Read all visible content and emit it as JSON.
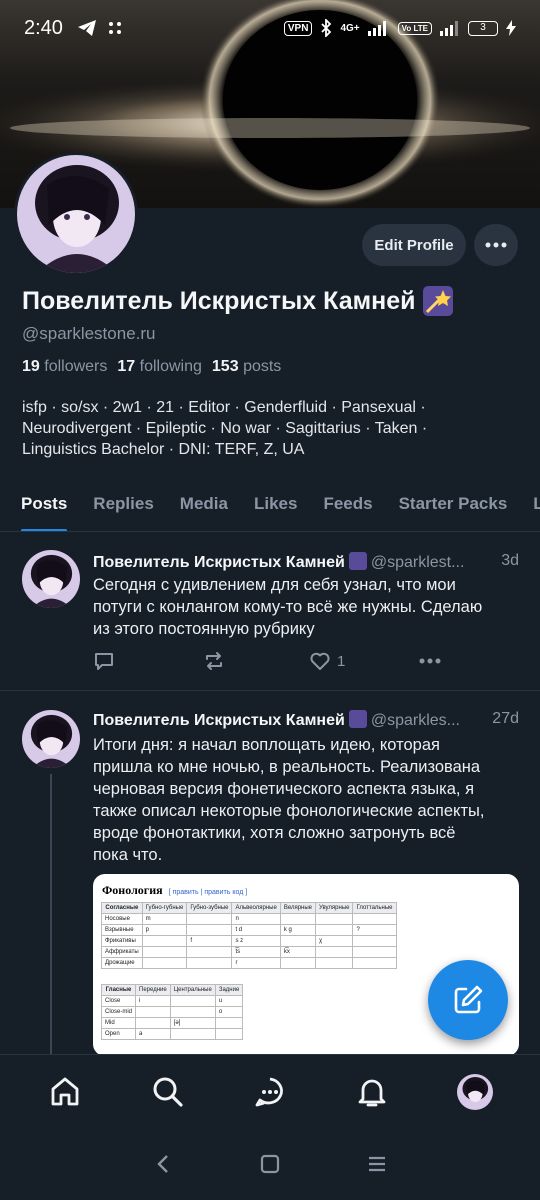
{
  "status_bar": {
    "time": "2:40",
    "vpn": "VPN",
    "network": "4G+",
    "volte": "Vo LTE",
    "battery": "3"
  },
  "profile": {
    "display_name": "Повелитель Искристых Камней",
    "handle": "@sparklestone.ru",
    "edit_label": "Edit Profile",
    "stats": {
      "followers_count": "19",
      "followers_label": "followers",
      "following_count": "17",
      "following_label": "following",
      "posts_count": "153",
      "posts_label": "posts"
    },
    "bio_lines": [
      "isfp · so/sx · 2w1 · 21 · Editor · Genderfluid · Pansexual ·",
      "Neurodivergent · Epileptic · No war · Sagittarius · Taken ·",
      "Linguistics Bachelor · DNI: TERF, Z, UA"
    ]
  },
  "tabs": [
    {
      "label": "Posts",
      "active": true
    },
    {
      "label": "Replies"
    },
    {
      "label": "Media"
    },
    {
      "label": "Likes"
    },
    {
      "label": "Feeds"
    },
    {
      "label": "Starter Packs"
    },
    {
      "label": "L"
    }
  ],
  "posts": [
    {
      "author": "Повелитель Искристых Камней",
      "handle": "@sparklest...",
      "age": "3d",
      "text_lines": [
        "Сегодня с удивлением для себя узнал, что мои",
        "потуги с конлангом кому-то всё же нужны. Сделаю",
        "из этого постоянную рубрику"
      ],
      "like_count": "1"
    },
    {
      "author": "Повелитель Искристых Камней",
      "handle": "@sparkles...",
      "age": "27d",
      "text_lines": [
        "Итоги дня: я начал воплощать идею, которая",
        "пришла ко мне ночью, в реальность. Реализована",
        "черновая версия фонетического аспекта языка, я",
        "также описал некоторые фонологические аспекты,",
        "вроде фонотактики, хотя сложно затронуть всё",
        "пока что."
      ],
      "image": {
        "title": "Фонология",
        "edit_links": "[ править | править код ]",
        "consonants": {
          "header": [
            "Согласные",
            "Губно-губные",
            "Губно-зубные",
            "Альвеолярные",
            "Велярные",
            "Увулярные",
            "Глоттальные"
          ],
          "rows": [
            [
              "Носовые",
              "m",
              "",
              "n",
              "",
              "",
              ""
            ],
            [
              "Взрывные",
              "p",
              "",
              "t    d",
              "k    g",
              "",
              "?"
            ],
            [
              "Фрикативы",
              "",
              "f",
              "s    z",
              "",
              "χ",
              ""
            ],
            [
              "Аффрикаты",
              "",
              "",
              "t͡s",
              "k͡x",
              "",
              ""
            ],
            [
              "Дрожащие",
              "",
              "",
              "r",
              "",
              "",
              ""
            ]
          ]
        },
        "vowels": {
          "header": [
            "Гласные",
            "Передние",
            "Центральные",
            "Задние"
          ],
          "rows": [
            [
              "Close",
              "i",
              "",
              "u"
            ],
            [
              "Close-mid",
              "",
              "",
              "o"
            ],
            [
              "Mid",
              "",
              "[ə]",
              ""
            ],
            [
              "Open",
              "a",
              "",
              ""
            ]
          ]
        }
      }
    }
  ],
  "colors": {
    "background": "#161e27",
    "accent": "#1e88e5",
    "muted": "#8a96a3",
    "button": "#2a3440"
  }
}
